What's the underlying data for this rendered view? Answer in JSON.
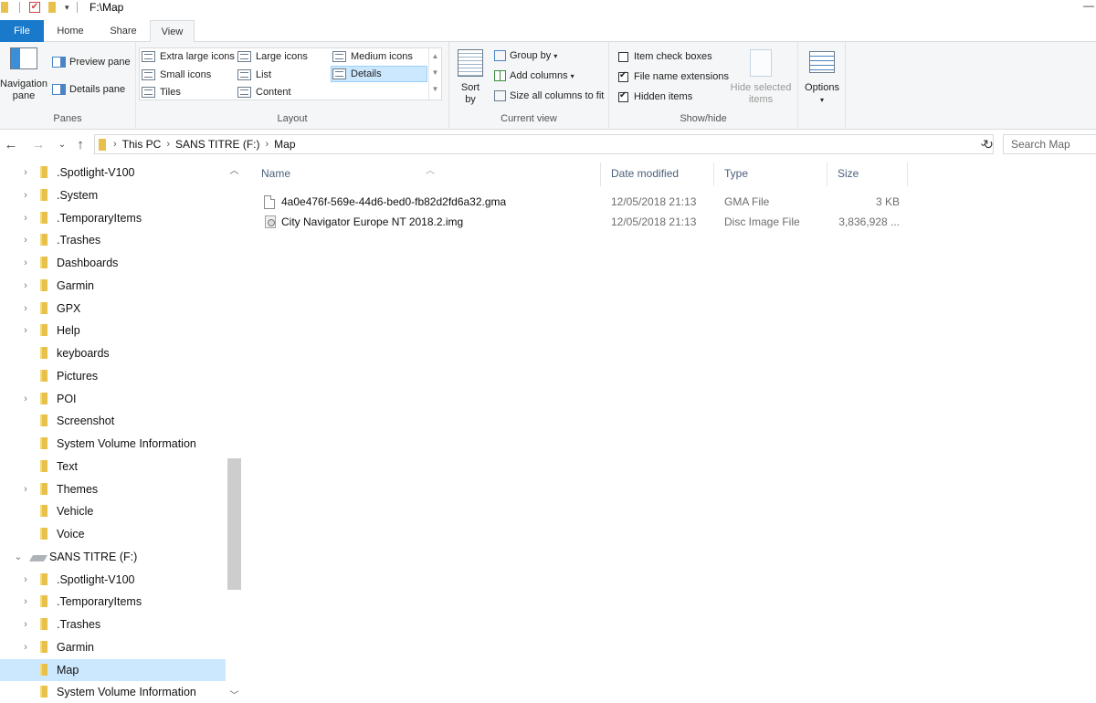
{
  "window": {
    "title": "F:\\Map"
  },
  "ribbon": {
    "tabs": {
      "file": "File",
      "home": "Home",
      "share": "Share",
      "view": "View"
    },
    "panes": {
      "label": "Panes",
      "navigation_pane": "Navigation pane",
      "preview_pane": "Preview pane",
      "details_pane": "Details pane"
    },
    "layout": {
      "label": "Layout",
      "extra_large_icons": "Extra large icons",
      "large_icons": "Large icons",
      "medium_icons": "Medium icons",
      "small_icons": "Small icons",
      "list": "List",
      "details": "Details",
      "tiles": "Tiles",
      "content": "Content",
      "selected": "Details"
    },
    "current_view": {
      "label": "Current view",
      "sort_by": "Sort by",
      "group_by": "Group by",
      "add_columns": "Add columns",
      "size_all_columns": "Size all columns to fit"
    },
    "show_hide": {
      "label": "Show/hide",
      "item_check_boxes": "Item check boxes",
      "item_check_boxes_checked": false,
      "file_name_extensions": "File name extensions",
      "file_name_extensions_checked": true,
      "hidden_items": "Hidden items",
      "hidden_items_checked": true,
      "hide_selected_items": "Hide selected items"
    },
    "options": "Options"
  },
  "address": {
    "crumbs": [
      "This PC",
      "SANS TITRE (F:)",
      "Map"
    ],
    "search_placeholder": "Search Map"
  },
  "tree": [
    {
      "label": ".Spotlight-V100",
      "expandable": true,
      "selected": false
    },
    {
      "label": ".System",
      "expandable": true,
      "selected": false
    },
    {
      "label": ".TemporaryItems",
      "expandable": true,
      "selected": false
    },
    {
      "label": ".Trashes",
      "expandable": true,
      "selected": false
    },
    {
      "label": "Dashboards",
      "expandable": true,
      "selected": false
    },
    {
      "label": "Garmin",
      "expandable": true,
      "selected": false
    },
    {
      "label": "GPX",
      "expandable": true,
      "selected": false
    },
    {
      "label": "Help",
      "expandable": true,
      "selected": false
    },
    {
      "label": "keyboards",
      "expandable": false,
      "selected": false
    },
    {
      "label": "Pictures",
      "expandable": false,
      "selected": false
    },
    {
      "label": "POI",
      "expandable": true,
      "selected": false
    },
    {
      "label": "Screenshot",
      "expandable": false,
      "selected": false
    },
    {
      "label": "System Volume Information",
      "expandable": false,
      "selected": false
    },
    {
      "label": "Text",
      "expandable": false,
      "selected": false
    },
    {
      "label": "Themes",
      "expandable": true,
      "selected": false
    },
    {
      "label": "Vehicle",
      "expandable": false,
      "selected": false
    },
    {
      "label": "Voice",
      "expandable": false,
      "selected": false
    },
    {
      "label": "SANS TITRE (F:)",
      "expandable": true,
      "expanded": true,
      "drive": true,
      "selected": false
    },
    {
      "label": ".Spotlight-V100",
      "expandable": true,
      "selected": false
    },
    {
      "label": ".TemporaryItems",
      "expandable": true,
      "selected": false
    },
    {
      "label": ".Trashes",
      "expandable": true,
      "selected": false
    },
    {
      "label": "Garmin",
      "expandable": true,
      "selected": false
    },
    {
      "label": "Map",
      "expandable": false,
      "selected": true
    },
    {
      "label": "System Volume Information",
      "expandable": false,
      "selected": false
    }
  ],
  "list": {
    "columns": {
      "name": "Name",
      "date": "Date modified",
      "type": "Type",
      "size": "Size"
    },
    "files": [
      {
        "name": "4a0e476f-569e-44d6-bed0-fb82d2fd6a32.gma",
        "date": "12/05/2018 21:13",
        "type": "GMA File",
        "size": "3 KB",
        "icon": "file-icon"
      },
      {
        "name": "City Navigator Europe NT 2018.2.img",
        "date": "12/05/2018 21:13",
        "type": "Disc Image File",
        "size": "3,836,928 ...",
        "icon": "disc-image-icon"
      }
    ]
  }
}
